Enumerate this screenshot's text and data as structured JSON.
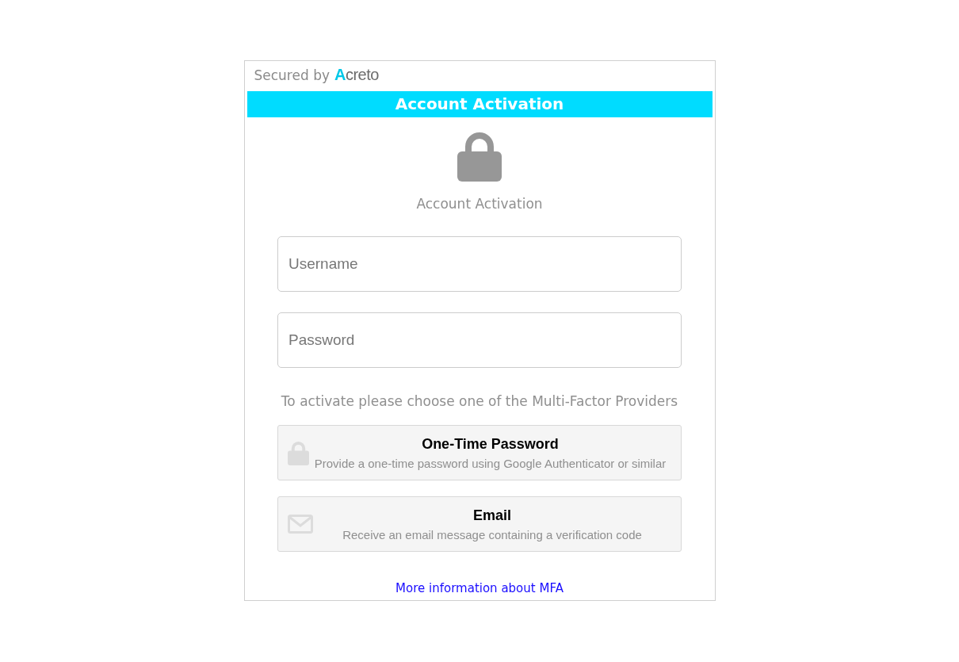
{
  "secured_by": {
    "label": "Secured by",
    "logo": "Acreto"
  },
  "banner": "Account Activation",
  "heading": "Account Activation",
  "fields": [
    {
      "placeholder": "Username"
    },
    {
      "placeholder": "Password"
    }
  ],
  "instruction": "To activate please choose one of the Multi-Factor Providers",
  "providers": [
    {
      "kind": "otp",
      "title": "One-Time Password",
      "description": "Provide a one-time password using Google Authenticator or similar"
    },
    {
      "kind": "email",
      "title": "Email",
      "description": "Receive an email message containing a verification code"
    }
  ],
  "link": "More information about MFA"
}
